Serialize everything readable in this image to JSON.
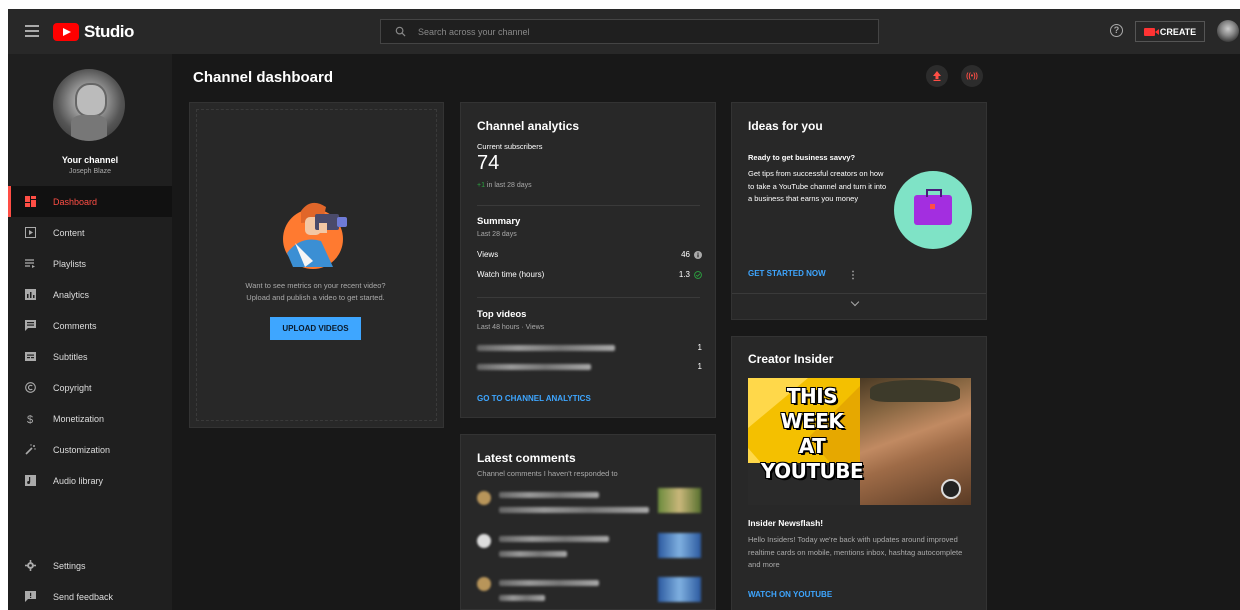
{
  "header": {
    "logo_text": "Studio",
    "search_placeholder": "Search across your channel",
    "create_label": "CREATE"
  },
  "sidebar": {
    "channel_title": "Your channel",
    "channel_name": "Joseph Blaze",
    "items": [
      {
        "label": "Dashboard",
        "icon": "dashboard-icon",
        "active": true
      },
      {
        "label": "Content",
        "icon": "content-icon"
      },
      {
        "label": "Playlists",
        "icon": "playlists-icon"
      },
      {
        "label": "Analytics",
        "icon": "analytics-icon"
      },
      {
        "label": "Comments",
        "icon": "comments-icon"
      },
      {
        "label": "Subtitles",
        "icon": "subtitles-icon"
      },
      {
        "label": "Copyright",
        "icon": "copyright-icon"
      },
      {
        "label": "Monetization",
        "icon": "monetization-icon"
      },
      {
        "label": "Customization",
        "icon": "customization-icon"
      },
      {
        "label": "Audio library",
        "icon": "audio-library-icon"
      }
    ],
    "settings_label": "Settings",
    "feedback_label": "Send feedback"
  },
  "main": {
    "title": "Channel dashboard",
    "live_icon_text": "((•))",
    "video_card": {
      "prompt_line1": "Want to see metrics on your recent video?",
      "prompt_line2": "Upload and publish a video to get started.",
      "upload_button": "UPLOAD VIDEOS"
    },
    "analytics": {
      "title": "Channel analytics",
      "subs_label": "Current subscribers",
      "subs_count": "74",
      "subs_change_value": "+1",
      "subs_change_text": " in last 28 days",
      "summary_title": "Summary",
      "summary_period": "Last 28 days",
      "views_label": "Views",
      "views_value": "46",
      "watch_label": "Watch time (hours)",
      "watch_value": "1.3",
      "top_videos_title": "Top videos",
      "top_videos_period": "Last 48 hours · Views",
      "top_video_values": [
        "1",
        "1"
      ],
      "link": "GO TO CHANNEL ANALYTICS"
    },
    "ideas": {
      "title": "Ideas for you",
      "headline": "Ready to get business savvy?",
      "body": "Get tips from successful creators on how to take a YouTube channel and turn it into a business that earns you money",
      "link": "GET STARTED NOW"
    },
    "insider": {
      "title": "Creator Insider",
      "thumb_line1": "THIS",
      "thumb_line2": "WEEK",
      "thumb_line3": "AT",
      "thumb_line4": "YOUTUBE",
      "news_title": "Insider Newsflash!",
      "news_body": "Hello Insiders! Today we're back with updates around improved realtime cards on mobile, mentions inbox, hashtag autocomplete and more",
      "link": "WATCH ON YOUTUBE"
    },
    "comments": {
      "title": "Latest comments",
      "subtitle": "Channel comments I haven't responded to"
    }
  },
  "colors": {
    "accent_red": "#ff4e45",
    "link_blue": "#3ea6ff",
    "positive_green": "#2ba640",
    "background": "#181818",
    "card": "#282828"
  }
}
